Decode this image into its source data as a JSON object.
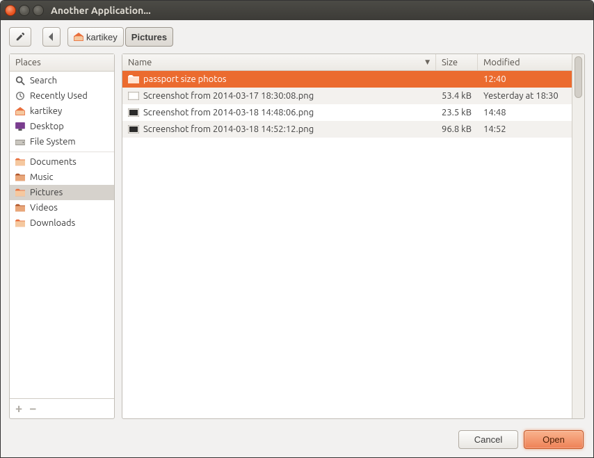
{
  "window": {
    "title": "Another Application..."
  },
  "toolbar": {
    "edit_tooltip": "Type a file name",
    "back_tooltip": "Back"
  },
  "path": {
    "home_label": "kartikey",
    "current_label": "Pictures"
  },
  "sidebar": {
    "header": "Places",
    "items": [
      {
        "icon": "search-icon",
        "label": "Search"
      },
      {
        "icon": "recent-icon",
        "label": "Recently Used"
      },
      {
        "icon": "home-icon",
        "label": "kartikey"
      },
      {
        "icon": "desktop-icon",
        "label": "Desktop"
      },
      {
        "icon": "drive-icon",
        "label": "File System"
      },
      {
        "icon": "folder-icon",
        "label": "Documents"
      },
      {
        "icon": "folder-icon",
        "label": "Music"
      },
      {
        "icon": "folder-icon",
        "label": "Pictures"
      },
      {
        "icon": "folder-icon",
        "label": "Videos"
      },
      {
        "icon": "folder-icon",
        "label": "Downloads"
      }
    ],
    "selected_index": 7,
    "separator_before_index": 5,
    "add_label": "+",
    "remove_label": "−"
  },
  "columns": {
    "name": "Name",
    "size": "Size",
    "modified": "Modified"
  },
  "files": [
    {
      "icon": "folder-open-icon",
      "name": "passport size photos",
      "size": "",
      "modified": "12:40",
      "selected": true
    },
    {
      "icon": "image-icon",
      "name": "Screenshot from 2014-03-17 18:30:08.png",
      "size": "53.4 kB",
      "modified": "Yesterday at 18:30",
      "selected": false
    },
    {
      "icon": "image-icon-dark",
      "name": "Screenshot from 2014-03-18 14:48:06.png",
      "size": "23.5 kB",
      "modified": "14:48",
      "selected": false
    },
    {
      "icon": "image-icon-dark",
      "name": "Screenshot from 2014-03-18 14:52:12.png",
      "size": "96.8 kB",
      "modified": "14:52",
      "selected": false
    }
  ],
  "buttons": {
    "cancel": "Cancel",
    "open": "Open"
  },
  "colors": {
    "accent": "#eb6b2f"
  }
}
